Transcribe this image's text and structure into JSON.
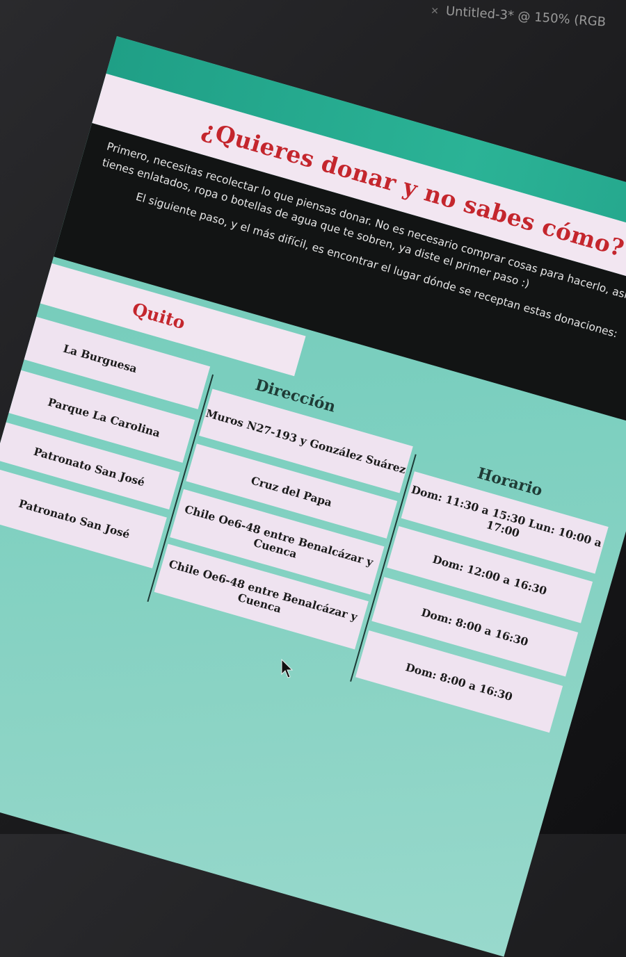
{
  "window": {
    "title": "Untitled-3* @ 150% (RGB"
  },
  "page": {
    "title": "¿Quieres donar y no sabes cómo?",
    "intro": {
      "p1": "Primero, necesitas recolectar lo que piensas donar. No es necesario comprar cosas para hacerlo, así que si tienes enlatados, ropa o botellas de agua que te sobren, ya diste el primer paso :)",
      "p2": "El siguiente paso, y el más difícil, es encontrar el lugar dónde se receptan estas donaciones:"
    },
    "city": "Quito",
    "table": {
      "headers": {
        "direccion": "Dirección",
        "horario": "Horario"
      },
      "rows": [
        {
          "name": "La Burguesa",
          "direccion": "Muros N27-193 y González Suárez",
          "horario": "Dom: 11:30 a 15:30 Lun: 10:00 a 17:00"
        },
        {
          "name": "Parque La Carolina",
          "direccion": "Cruz del Papa",
          "horario": "Dom: 12:00 a 16:30"
        },
        {
          "name": "Patronato San José",
          "direccion": "Chile Oe6-48 entre Benalcázar y Cuenca",
          "horario": "Dom: 8:00 a 16:30"
        },
        {
          "name": "Patronato San José",
          "direccion": "Chile Oe6-48 entre Benalcázar y Cuenca",
          "horario": "Dom: 8:00 a 16:30"
        }
      ]
    }
  },
  "colors": {
    "accent_red": "#c4262d",
    "teal": "#7bcfbf",
    "cell_pink": "#efe3f0",
    "intro_bg": "#121414"
  },
  "icons": {
    "cursor": "arrow-cursor-icon",
    "close": "close-x-icon"
  }
}
